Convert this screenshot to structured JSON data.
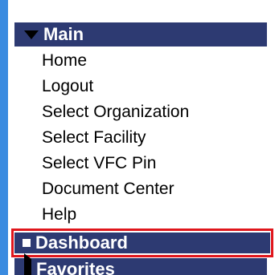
{
  "menu": {
    "main": {
      "label": "Main",
      "icon": "caret-down-icon",
      "items": [
        {
          "label": "Home"
        },
        {
          "label": "Logout"
        },
        {
          "label": "Select Organization"
        },
        {
          "label": "Select Facility"
        },
        {
          "label": "Select VFC Pin"
        },
        {
          "label": "Document Center"
        },
        {
          "label": "Help"
        }
      ]
    },
    "dashboard": {
      "label": "Dashboard",
      "icon": "square-bullet-icon",
      "highlight_color": "#e0161c"
    },
    "favorites": {
      "label": "Favorites",
      "icon": "caret-right-icon"
    }
  },
  "colors": {
    "header_bg": "#2d3a72",
    "left_border": "#3a8be0",
    "text": "#000000"
  }
}
